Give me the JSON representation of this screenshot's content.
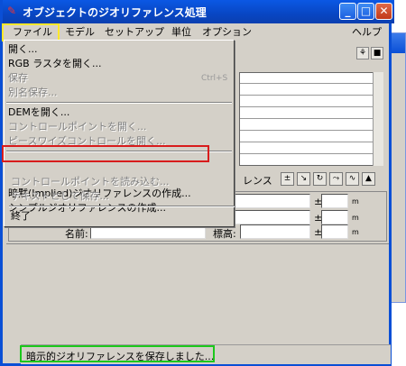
{
  "window": {
    "title": "オブジェクトのジオリファレンス処理",
    "minimize": "_",
    "maximize": "□",
    "close": "✕"
  },
  "menubar": {
    "items": [
      {
        "label": "ファイル"
      },
      {
        "label": "モデル"
      },
      {
        "label": "セットアップ"
      },
      {
        "label": "単位"
      },
      {
        "label": "オプション"
      },
      {
        "label": "ヘルプ"
      }
    ]
  },
  "file_menu": {
    "items": [
      {
        "label": "開く...",
        "enabled": true
      },
      {
        "label": "RGB ラスタを開く...",
        "enabled": true
      },
      {
        "label": "保存",
        "shortcut": "Ctrl+S",
        "enabled": false
      },
      {
        "label": "別名保存...",
        "enabled": false
      },
      {
        "label": "DEMを開く...",
        "enabled": true
      },
      {
        "label": "コントロールポイントを開く...",
        "enabled": false
      },
      {
        "label": "ピースワイズコントロールを開く...",
        "enabled": false
      },
      {
        "label": "暗黙(Implied)ジオリファレンスの作成...",
        "enabled": true,
        "highlighted": true
      },
      {
        "label": "シンプルジオリファレンスの作成...",
        "enabled": true
      },
      {
        "label": "コントロールポイントを読み込む...",
        "enabled": false
      },
      {
        "label": "テキストとして保存...",
        "enabled": false
      },
      {
        "label": "終了",
        "enabled": true
      }
    ]
  },
  "main_panel": {
    "reference_label": "レンス",
    "plus_minus": "±",
    "unit_m": "m",
    "name_label": "名前:",
    "elevation_label": "標高:"
  },
  "status": {
    "message": "暗示的ジオリファレンスを保存しました..."
  },
  "colors": {
    "title_bar": "#0a4fd6",
    "highlight_red": "#d81c1c",
    "highlight_yellow": "#ffe82a",
    "highlight_green": "#1cc81c"
  }
}
